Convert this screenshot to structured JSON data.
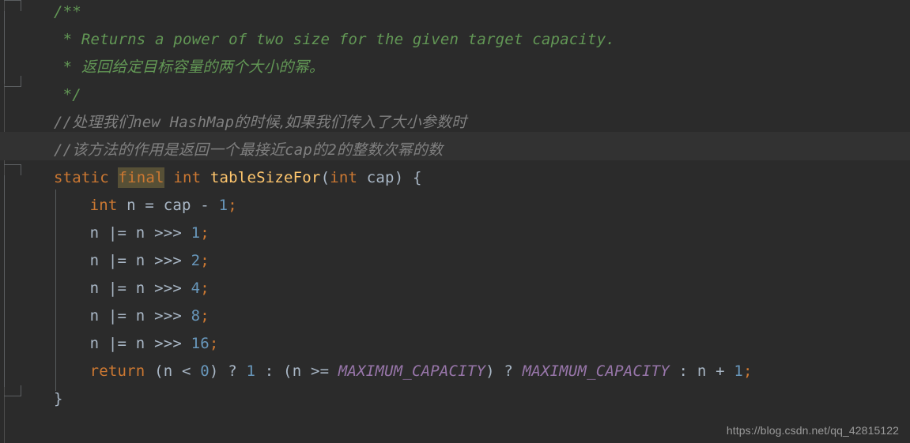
{
  "editor": {
    "theme_name": "Darcula",
    "background_color": "#2b2b2b",
    "caret_line_color": "#323232",
    "colors": {
      "javadoc": "#629755",
      "line_comment": "#808080",
      "keyword": "#cc7832",
      "identifier": "#a9b7c6",
      "number": "#6897bb",
      "method_name": "#ffc66d",
      "static_field": "#9876aa",
      "semicolon": "#cc7832",
      "identifier_highlight_bg": "#575036",
      "gutter_line": "#5c5f61",
      "watermark": "#9a9a9a"
    }
  },
  "code": {
    "lines": [
      {
        "id": "line-1",
        "tokens": [
          {
            "cls": "doc",
            "text": "/**"
          }
        ]
      },
      {
        "id": "line-2",
        "tokens": [
          {
            "cls": "doc",
            "text": " * Returns a power of two size for the given target capacity."
          }
        ]
      },
      {
        "id": "line-3",
        "tokens": [
          {
            "cls": "doc",
            "text": " * "
          },
          {
            "cls": "doc cjk",
            "text": "返回给定目标容量的两个大小的幂。"
          }
        ]
      },
      {
        "id": "line-4",
        "tokens": [
          {
            "cls": "doc",
            "text": " */"
          }
        ]
      },
      {
        "id": "line-5",
        "tokens": [
          {
            "cls": "cmt",
            "text": "//"
          },
          {
            "cls": "cmt cjk",
            "text": "处理我们"
          },
          {
            "cls": "cmt",
            "text": "new HashMap"
          },
          {
            "cls": "cmt cjk",
            "text": "的时候,如果我们传入了大小参数时"
          }
        ]
      },
      {
        "id": "line-6",
        "tokens": [
          {
            "cls": "cmt",
            "text": "//"
          },
          {
            "cls": "cmt cjk",
            "text": "该方法的作用是返回一个最接近"
          },
          {
            "cls": "cmt",
            "text": "cap"
          },
          {
            "cls": "cmt cjk",
            "text": "的"
          },
          {
            "cls": "cmt",
            "text": "2"
          },
          {
            "cls": "cmt cjk",
            "text": "的整数次幂的数"
          }
        ]
      },
      {
        "id": "line-7",
        "tokens": [
          {
            "cls": "kw",
            "text": "static "
          },
          {
            "cls": "hl-final",
            "text": "final"
          },
          {
            "cls": "kw",
            "text": " int "
          },
          {
            "cls": "meth",
            "text": "tableSizeFor"
          },
          {
            "cls": "punc",
            "text": "("
          },
          {
            "cls": "kw",
            "text": "int"
          },
          {
            "cls": "ident",
            "text": " cap"
          },
          {
            "cls": "punc",
            "text": ") "
          },
          {
            "cls": "brace",
            "text": "{"
          }
        ]
      },
      {
        "id": "line-8",
        "indent": 4,
        "tokens": [
          {
            "cls": "kw",
            "text": "int"
          },
          {
            "cls": "ident",
            "text": " n = cap "
          },
          {
            "cls": "punc",
            "text": "- "
          },
          {
            "cls": "num",
            "text": "1"
          },
          {
            "cls": "semi",
            "text": ";"
          }
        ]
      },
      {
        "id": "line-9",
        "indent": 4,
        "tokens": [
          {
            "cls": "ident",
            "text": "n |= n >>> "
          },
          {
            "cls": "num",
            "text": "1"
          },
          {
            "cls": "semi",
            "text": ";"
          }
        ]
      },
      {
        "id": "line-10",
        "indent": 4,
        "tokens": [
          {
            "cls": "ident",
            "text": "n |= n >>> "
          },
          {
            "cls": "num",
            "text": "2"
          },
          {
            "cls": "semi",
            "text": ";"
          }
        ]
      },
      {
        "id": "line-11",
        "indent": 4,
        "tokens": [
          {
            "cls": "ident",
            "text": "n |= n >>> "
          },
          {
            "cls": "num",
            "text": "4"
          },
          {
            "cls": "semi",
            "text": ";"
          }
        ]
      },
      {
        "id": "line-12",
        "indent": 4,
        "tokens": [
          {
            "cls": "ident",
            "text": "n |= n >>> "
          },
          {
            "cls": "num",
            "text": "8"
          },
          {
            "cls": "semi",
            "text": ";"
          }
        ]
      },
      {
        "id": "line-13",
        "indent": 4,
        "tokens": [
          {
            "cls": "ident",
            "text": "n |= n >>> "
          },
          {
            "cls": "num",
            "text": "16"
          },
          {
            "cls": "semi",
            "text": ";"
          }
        ]
      },
      {
        "id": "line-14",
        "indent": 4,
        "tokens": [
          {
            "cls": "kw",
            "text": "return"
          },
          {
            "cls": "ident",
            "text": " "
          },
          {
            "cls": "punc",
            "text": "("
          },
          {
            "cls": "ident",
            "text": "n < "
          },
          {
            "cls": "num",
            "text": "0"
          },
          {
            "cls": "punc",
            "text": ")"
          },
          {
            "cls": "ident",
            "text": " ? "
          },
          {
            "cls": "num",
            "text": "1"
          },
          {
            "cls": "ident",
            "text": " : "
          },
          {
            "cls": "punc",
            "text": "("
          },
          {
            "cls": "ident",
            "text": "n >= "
          },
          {
            "cls": "statfield",
            "text": "MAXIMUM_CAPACITY"
          },
          {
            "cls": "punc",
            "text": ")"
          },
          {
            "cls": "ident",
            "text": " ? "
          },
          {
            "cls": "statfield",
            "text": "MAXIMUM_CAPACITY"
          },
          {
            "cls": "ident",
            "text": " : n + "
          },
          {
            "cls": "num",
            "text": "1"
          },
          {
            "cls": "semi",
            "text": ";"
          }
        ]
      },
      {
        "id": "line-15",
        "tokens": [
          {
            "cls": "brace",
            "text": "}"
          }
        ]
      }
    ]
  },
  "watermark": {
    "text": "https://blog.csdn.net/qq_42815122"
  }
}
